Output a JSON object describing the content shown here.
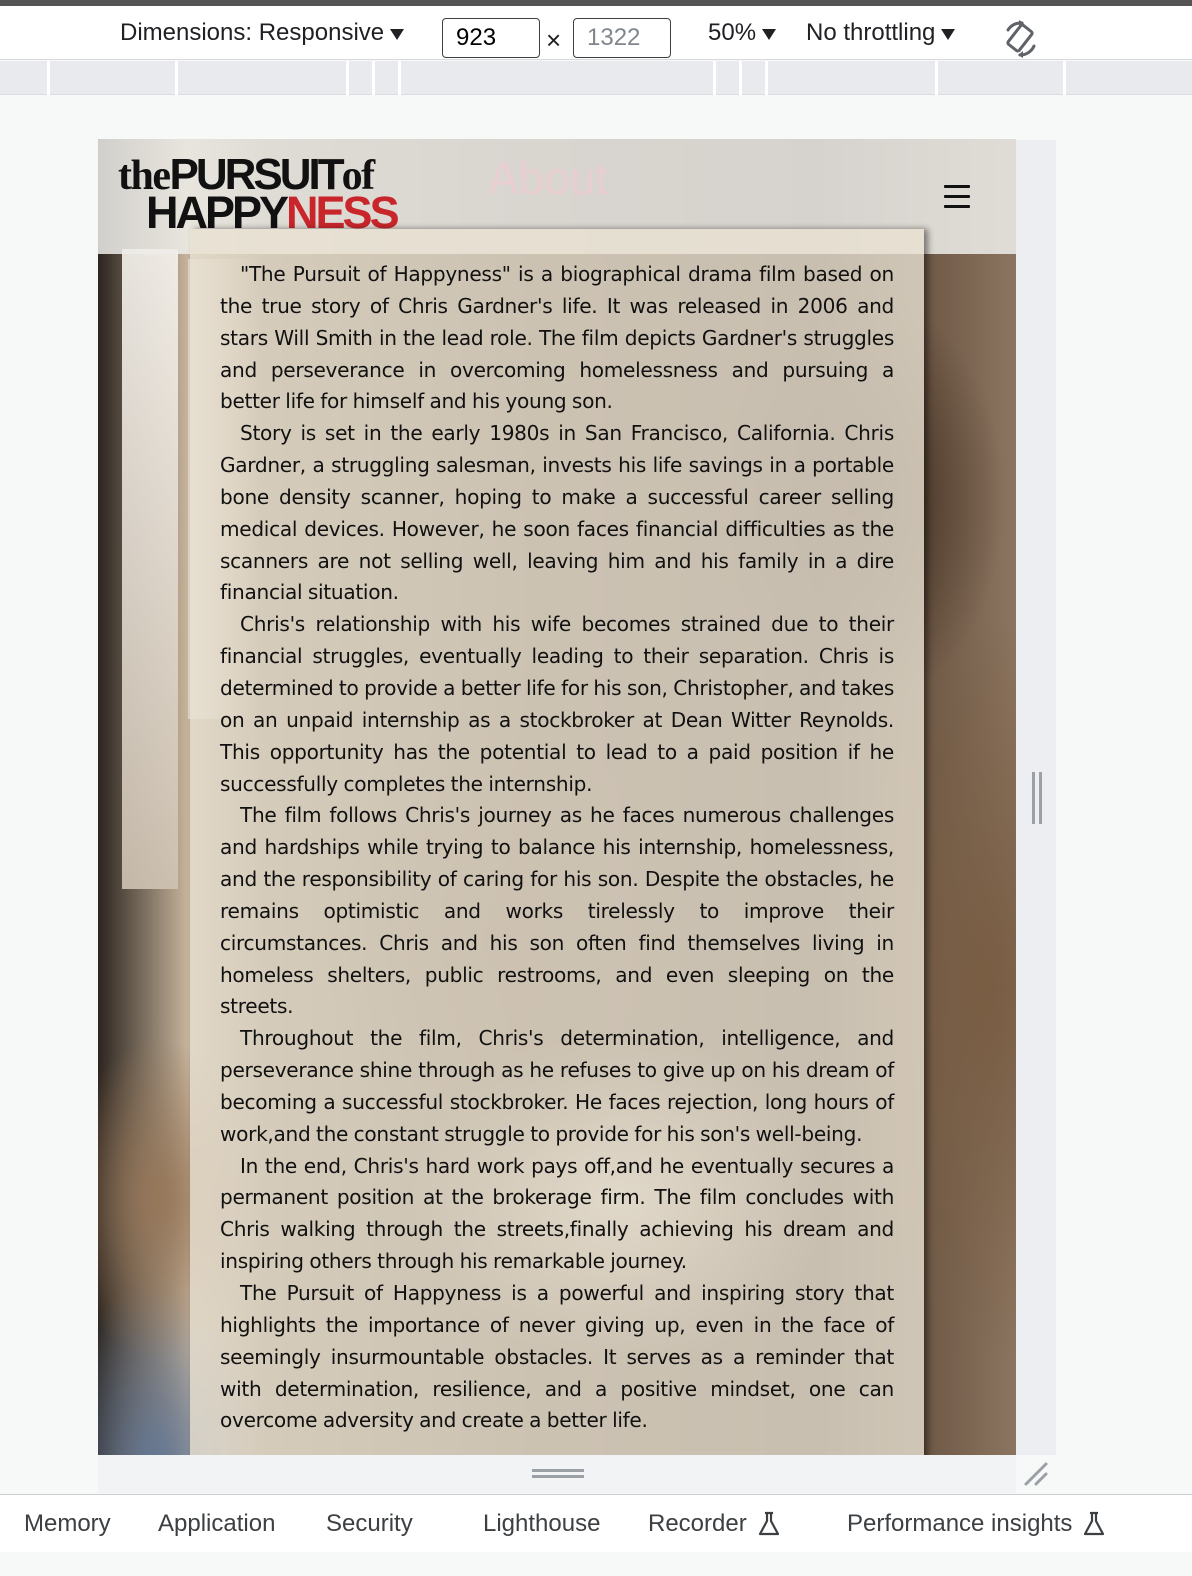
{
  "devtools": {
    "dimensions_label": "Dimensions: Responsive",
    "width_value": "923",
    "height_placeholder": "1322",
    "times_sign": "×",
    "zoom": "50%",
    "throttling": "No throttling"
  },
  "site": {
    "logo_the": "the",
    "logo_pursuit": "PURSUIT",
    "logo_of": "of",
    "logo_happy": "HAPPY",
    "logo_ness": "NESS",
    "nav_about": "About",
    "paragraphs": [
      "\"The Pursuit of Happyness\" is a biographical drama film based on the true story of Chris Gardner's life. It was released in 2006 and stars Will Smith in the lead role. The film depicts Gardner's struggles and perseverance in overcoming homelessness and pursuing a better life for himself and his young son.",
      "Story is set in the early 1980s in San Francisco, California. Chris Gardner, a struggling salesman, invests his life savings in a portable bone density scanner, hoping to make a successful career selling medical devices. However, he soon faces financial difficulties as the scanners are not selling well, leaving him and his family in a dire financial situation.",
      "Chris's relationship with his wife becomes strained due to their financial struggles, eventually leading to their separation. Chris is determined to provide a better life for his son, Christopher, and takes on an unpaid internship as a stockbroker at Dean Witter Reynolds. This opportunity has the potential to lead to a paid position if he successfully completes the internship.",
      "The film follows Chris's journey as he faces numerous challenges and hardships while trying to balance his internship, homelessness, and the responsibility of caring for his son. Despite the obstacles, he remains optimistic and works tirelessly to improve their circumstances. Chris and his son often find themselves living in homeless shelters, public restrooms, and even sleeping on the streets.",
      "Throughout the film, Chris's determination, intelligence, and perseverance shine through as he refuses to give up on his dream of becoming a successful stockbroker. He faces rejection, long hours of work,and the constant struggle to provide for his son's well-being.",
      "In the end, Chris's hard work pays off,and he eventually secures a permanent position at the brokerage firm. The film concludes with Chris walking through the streets,finally achieving his dream and inspiring others through his remarkable journey.",
      "The Pursuit of Happyness is a powerful and inspiring story that highlights the importance of never giving up, even in the face of seemingly insurmountable obstacles. It serves as a reminder that with determination, resilience, and a positive mindset, one can overcome adversity and create a better life."
    ]
  },
  "tabs": [
    {
      "label": "Memory",
      "experimental": false
    },
    {
      "label": "Application",
      "experimental": false
    },
    {
      "label": "Security",
      "experimental": false
    },
    {
      "label": "Lighthouse",
      "experimental": false
    },
    {
      "label": "Recorder",
      "experimental": true
    },
    {
      "label": "Performance insights",
      "experimental": true
    }
  ],
  "icons": {
    "rotate": "rotate-icon",
    "menu": "hamburger-menu-icon",
    "experiment": "flask-icon"
  },
  "colors": {
    "brand_red": "#c8262b",
    "about_link": "#f5c8d4"
  }
}
